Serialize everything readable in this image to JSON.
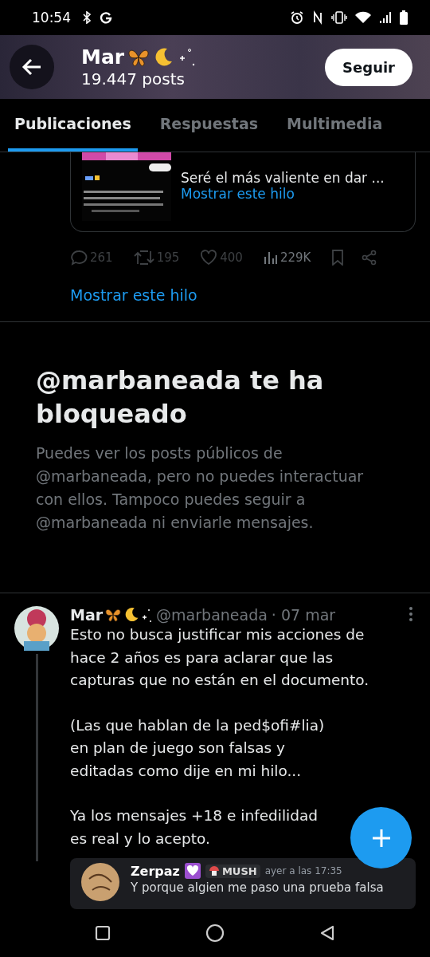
{
  "status_bar": {
    "time": "10:54"
  },
  "header": {
    "name": "Mar",
    "posts": "19.447 posts",
    "follow_button": "Seguir"
  },
  "tabs": [
    {
      "label": "Publicaciones",
      "selected": true
    },
    {
      "label": "Respuestas",
      "selected": false
    },
    {
      "label": "Multimedia",
      "selected": false
    }
  ],
  "quoted_post": {
    "text": "Seré el más valiente en dar ...",
    "link": "Mostrar este hilo"
  },
  "actions": [
    {
      "kind": "reply",
      "count": "261"
    },
    {
      "kind": "repost",
      "count": "195"
    },
    {
      "kind": "like",
      "count": "400"
    },
    {
      "kind": "views",
      "count": "229K"
    },
    {
      "kind": "bookmark"
    },
    {
      "kind": "share"
    }
  ],
  "thread_link": "Mostrar este hilo",
  "blocked": {
    "title": "@marbaneada te ha bloqueado",
    "body": "Puedes ver los posts públicos de @marbaneada, pero no puedes interactuar con ellos. Tampoco puedes seguir a @marbaneada ni enviarle mensajes."
  },
  "post": {
    "name": "Mar",
    "handle": "@marbaneada",
    "date": "· 07 mar",
    "paragraphs": [
      "Esto no busca justificar mis acciones de hace 2 años es para aclarar que las capturas que no están en el documento.",
      "(Las que hablan de la ped$ofi#lia)\nen plan de juego son falsas y\neditadas como dije en mi hilo...",
      "Ya los mensajes +18 e infedilidad\nes real y lo acepto."
    ],
    "embedded_message": {
      "author": "Zerpaz",
      "tag": "MUSH",
      "time": "ayer a las 17:35",
      "text": "Y porque algien me paso una prueba falsa"
    }
  }
}
